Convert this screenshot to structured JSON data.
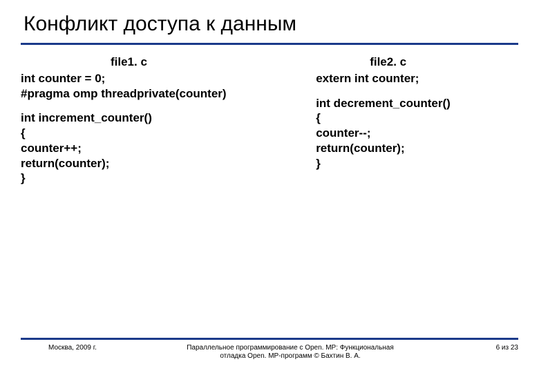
{
  "title": "Конфликт доступа к данным",
  "left": {
    "filename": "file1. c",
    "decl1": "int counter = 0;",
    "decl2": "#pragma omp threadprivate(counter)",
    "func_sig": "int increment_counter()",
    "brace_open": "{",
    "body1": "counter++;",
    "body2": "return(counter);",
    "brace_close": "}"
  },
  "right": {
    "filename": "file2. c",
    "decl1": "extern int counter;",
    "func_sig": "int decrement_counter()",
    "brace_open": "{",
    "body1": "counter--;",
    "body2": "return(counter);",
    "brace_close": "}"
  },
  "footer": {
    "left": "Москва, 2009 г.",
    "center_line1": "Параллельное программирование с Open. MP: Функциональная",
    "center_line2": "отладка Open. MP-программ © Бахтин В. А.",
    "right_prefix": "6",
    "right_mid": " из ",
    "right_suffix": "23"
  }
}
